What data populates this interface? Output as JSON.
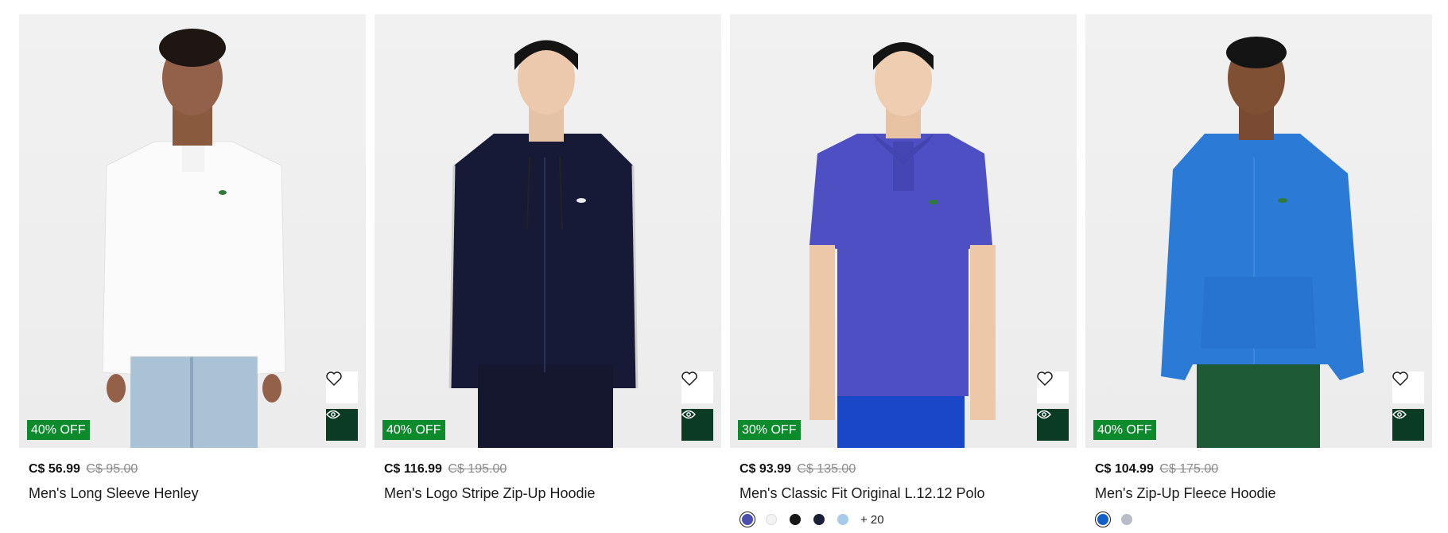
{
  "products": [
    {
      "badge": "40% OFF",
      "price_now": "C$ 56.99",
      "price_was": "C$ 95.00",
      "name": "Men's Long Sleeve Henley",
      "image": "man-white-henley-jeans"
    },
    {
      "badge": "40% OFF",
      "price_now": "C$ 116.99",
      "price_was": "C$ 195.00",
      "name": "Men's Logo Stripe Zip-Up Hoodie",
      "image": "man-navy-zip-hoodie"
    },
    {
      "badge": "30% OFF",
      "price_now": "C$ 93.99",
      "price_was": "C$ 135.00",
      "name": "Men's Classic Fit Original L.12.12 Polo",
      "image": "man-purple-polo",
      "swatch_colors": [
        "#4a4fb0",
        "#f3f3f3",
        "#161616",
        "#1b1f3a",
        "#a8cbeb"
      ],
      "more_colors": "+ 20"
    },
    {
      "badge": "40% OFF",
      "price_now": "C$ 104.99",
      "price_was": "C$ 175.00",
      "name": "Men's Zip-Up Fleece Hoodie",
      "image": "man-blue-fleece-hoodie",
      "swatch_colors": [
        "#1360c7",
        "#b7bcc6"
      ]
    }
  ],
  "icons": {
    "wishlist": "heart-icon",
    "quick_view": "eye-icon"
  },
  "colors": {
    "badge_green": "#0d8a2c",
    "quick_view_bg": "#0b3b24"
  }
}
